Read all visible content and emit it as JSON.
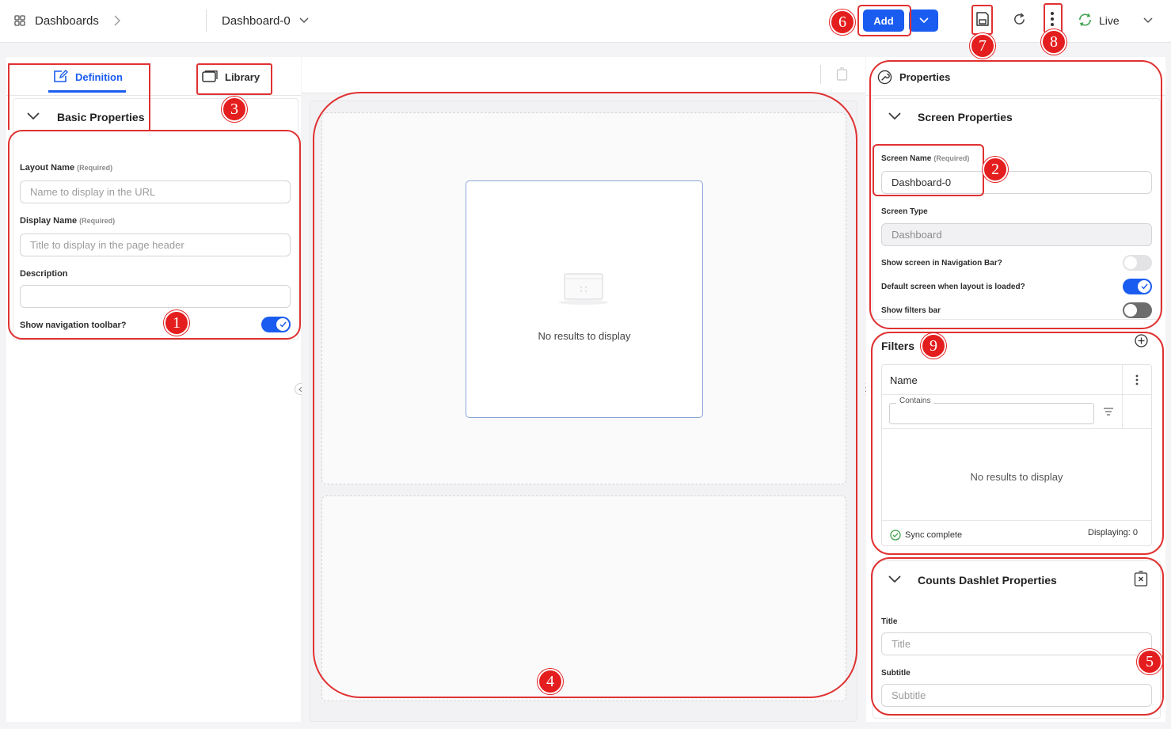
{
  "topbar": {
    "breadcrumb_root": "Dashboards",
    "dashboard_name": "Dashboard-0",
    "add_label": "Add",
    "live_label": "Live"
  },
  "left_panel": {
    "tabs": [
      {
        "label": "Definition",
        "icon": "edit-icon",
        "active": true
      },
      {
        "label": "Library",
        "icon": "library-icon",
        "active": false
      }
    ],
    "section_title": "Basic Properties",
    "fields": {
      "layout_name_label": "Layout Name",
      "layout_name_req": "(Required)",
      "layout_name_placeholder": "Name to display in the URL",
      "display_name_label": "Display Name",
      "display_name_req": "(Required)",
      "display_name_placeholder": "Title to display in the page header",
      "description_label": "Description",
      "description_value": "",
      "nav_toolbar_label": "Show navigation toolbar?",
      "nav_toolbar_on": true
    }
  },
  "canvas": {
    "empty_text": "No results to display"
  },
  "right_panel": {
    "header": "Properties",
    "screen_section_title": "Screen Properties",
    "screen_name_label": "Screen Name",
    "screen_name_req": "(Required)",
    "screen_name_value": "Dashboard-0",
    "screen_type_label": "Screen Type",
    "screen_type_value": "Dashboard",
    "toggles": [
      {
        "label": "Show screen in Navigation Bar?",
        "on": false
      },
      {
        "label": "Default screen when layout is loaded?",
        "on": true
      },
      {
        "label": "Show filters bar",
        "on": false
      }
    ],
    "filters": {
      "title": "Filters",
      "column_header": "Name",
      "contains_label": "Contains",
      "empty_text": "No results to display",
      "sync_text": "Sync complete",
      "displaying_text": "Displaying: 0"
    },
    "dashlet": {
      "title": "Counts Dashlet Properties",
      "title_label": "Title",
      "title_placeholder": "Title",
      "subtitle_label": "Subtitle",
      "subtitle_placeholder": "Subtitle"
    }
  },
  "annotations": [
    "1",
    "2",
    "3",
    "4",
    "5",
    "6",
    "7",
    "8",
    "9"
  ],
  "colors": {
    "accent": "#1a5cf0",
    "annotation": "#e41e1e",
    "success": "#3fa34d"
  }
}
